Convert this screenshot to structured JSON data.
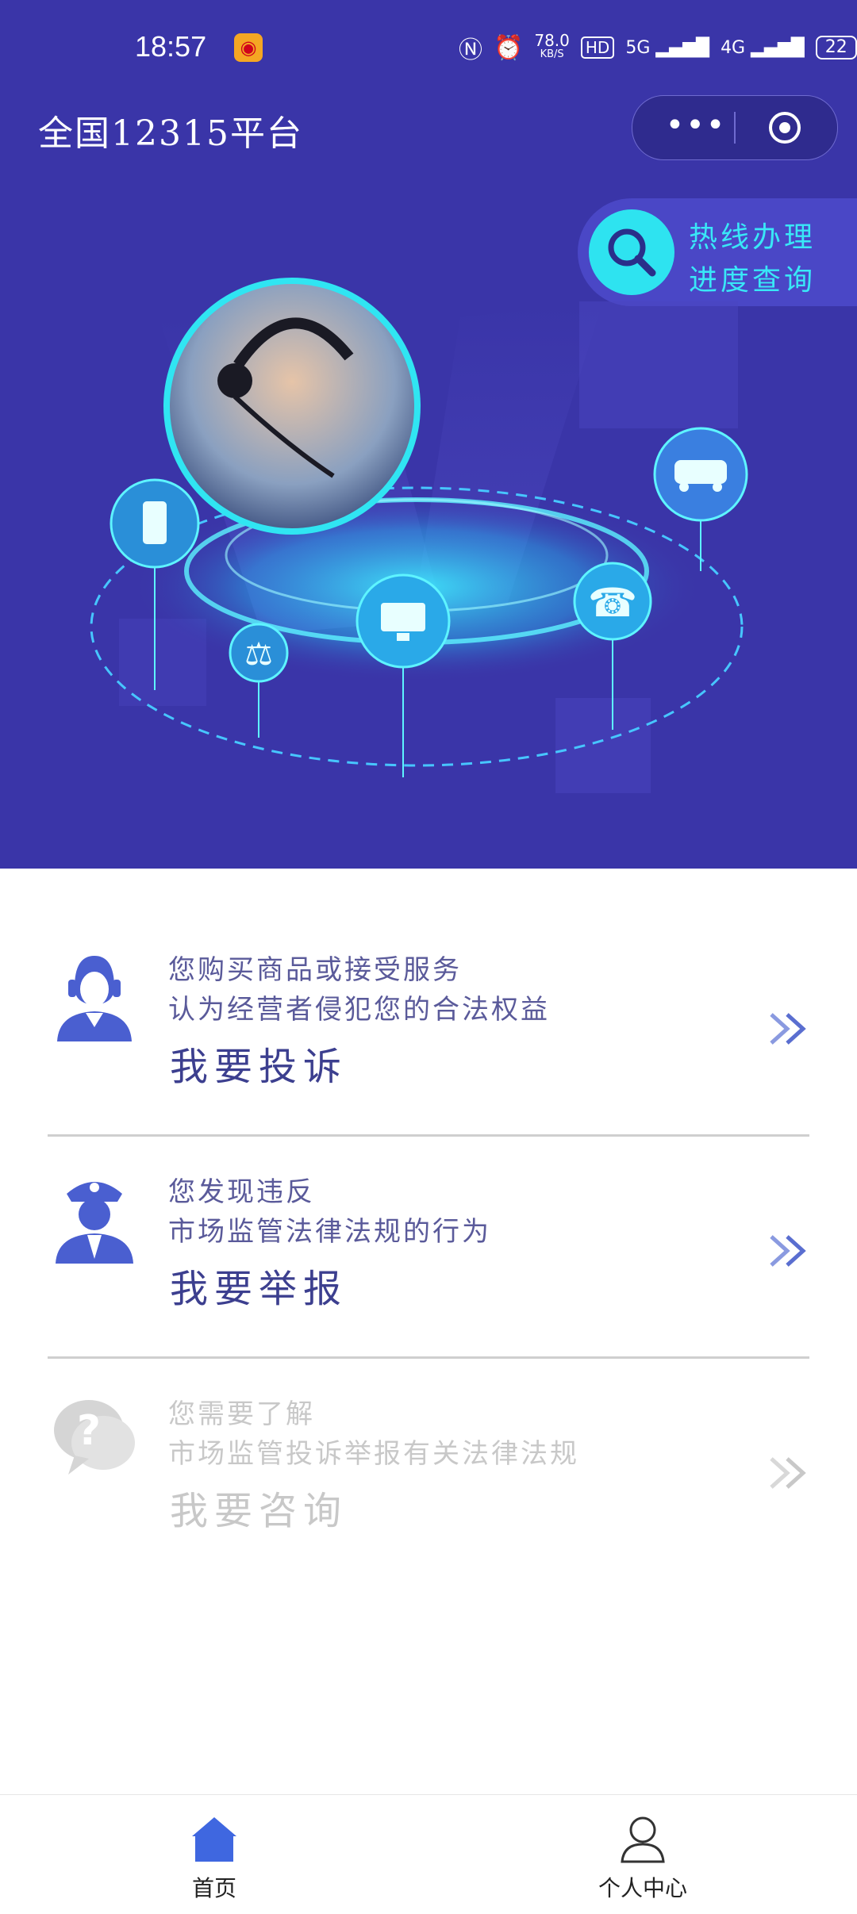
{
  "status_bar": {
    "time": "18:57",
    "speed_value": "78.0",
    "speed_unit": "KB/S",
    "hd_label": "HD",
    "net_5g": "5G",
    "net_4g": "4G",
    "battery": "22"
  },
  "header": {
    "title": "全国12315平台",
    "menu_dots": "•••"
  },
  "hotline": {
    "line1": "热线办理",
    "line2": "进度查询"
  },
  "items": [
    {
      "line1": "您购买商品或接受服务",
      "line2": "认为经营者侵犯您的合法权益",
      "action": "我要投诉",
      "icon": "customer-service-icon",
      "enabled": true
    },
    {
      "line1": "您发现违反",
      "line2": "市场监管法律法规的行为",
      "action": "我要举报",
      "icon": "police-officer-icon",
      "enabled": true
    },
    {
      "line1": "您需要了解",
      "line2": "市场监管投诉举报有关法律法规",
      "action": "我要咨询",
      "icon": "question-bubble-icon",
      "enabled": false
    }
  ],
  "tabbar": {
    "home_label": "首页",
    "profile_label": "个人中心"
  },
  "colors": {
    "hero_bg": "#3a35a8",
    "accent_cyan": "#2ee3f0",
    "icon_blue": "#4a5fd0",
    "text_purple": "#3c3f8f"
  }
}
